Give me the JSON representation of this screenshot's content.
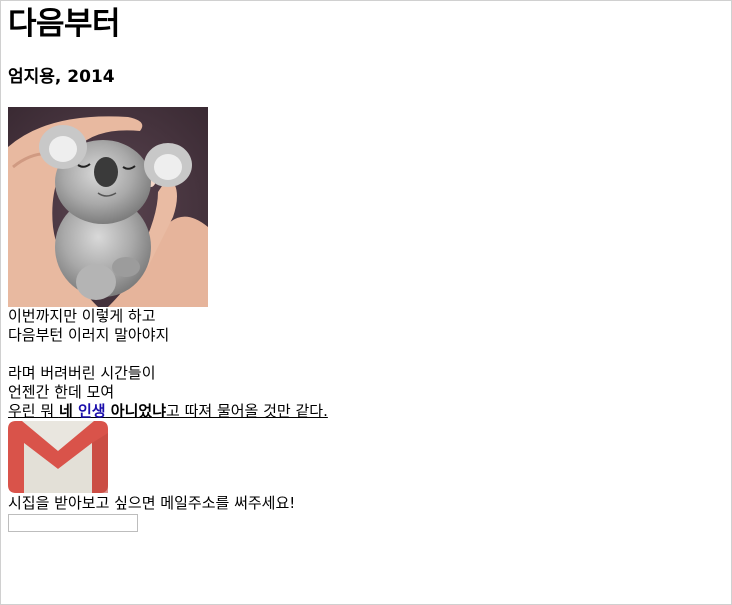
{
  "page": {
    "heading": "다음부터",
    "byline": "엄지용, 2014"
  },
  "poem": {
    "line1": "이번까지만 이렇게 하고",
    "line2": "다음부턴 이러지 말아야지",
    "line3": "라며 버려버린 시간들이",
    "line4": "언젠간 한데 모여",
    "line5_pre": "우린 뭐 ",
    "line5_bold1": "네 ",
    "line5_link": "인생",
    "line5_bold2": " 아니었냐",
    "line5_post": "고 따져 물어올 것만 같다."
  },
  "subscribe": {
    "label": "시집을 받아보고 싶으면 메일주소를 써주세요!",
    "input_value": "",
    "input_placeholder": ""
  },
  "images": {
    "photo": "koala-photo",
    "mail": "gmail-logo-icon"
  },
  "colors": {
    "link": "#1a0dab",
    "gmail_red": "#d9534a",
    "gmail_white": "#e9e6df"
  }
}
